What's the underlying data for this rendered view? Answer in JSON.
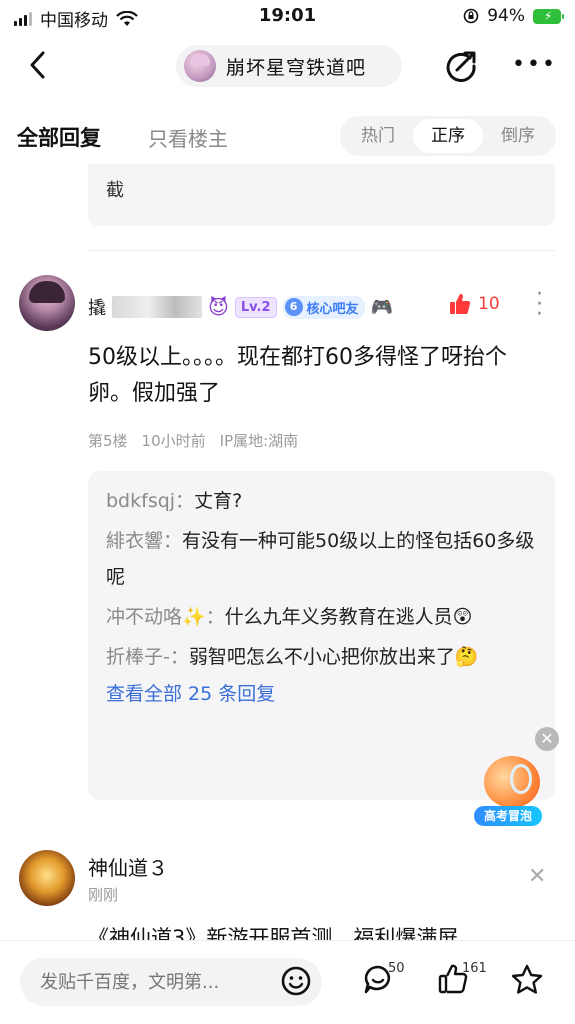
{
  "status": {
    "carrier": "中国移动",
    "time": "19:01",
    "battery": "94%"
  },
  "nav": {
    "forum_name": "崩坏星穹铁道吧"
  },
  "tabs": {
    "all": "全部回复",
    "op_only": "只看楼主",
    "sort": [
      "热门",
      "正序",
      "倒序"
    ],
    "sort_active": 1
  },
  "prev_reply": {
    "text": "截"
  },
  "post": {
    "username": "撬",
    "level": "Lv.2",
    "badge_num": "6",
    "badge_label": "核心吧友",
    "likes": "10",
    "body": "50级以上。。。。现在都打60多得怪了呀抬个卵。假加强了",
    "floor": "第5楼",
    "time": "10小时前",
    "ip": "IP属地:湖南"
  },
  "sub_replies": [
    {
      "user": "bdkfsqj：",
      "text": "丈育?"
    },
    {
      "user": "緋衣響：",
      "text": "有没有一种可能50级以上的怪包括60多级呢"
    },
    {
      "user": "冲不动咯✨：",
      "text": "什么九年义务教育在逃人员😲"
    },
    {
      "user": "折棒子-：",
      "text": "弱智吧怎么不小心把你放出来了🤔"
    }
  ],
  "view_all": "查看全部 25 条回复",
  "float_label": "高考冒泡",
  "ad": {
    "title": "神仙道３",
    "time": "刚刚",
    "body": "《神仙道3》新游开服首测，福利爆满屏"
  },
  "bottom": {
    "placeholder": "发贴千百度，文明第...",
    "comments": "50",
    "likes": "161"
  },
  "colors": {
    "like_red": "#ff3a3a",
    "link_blue": "#3a6fd8",
    "level_purple": "#8a4ee8"
  }
}
